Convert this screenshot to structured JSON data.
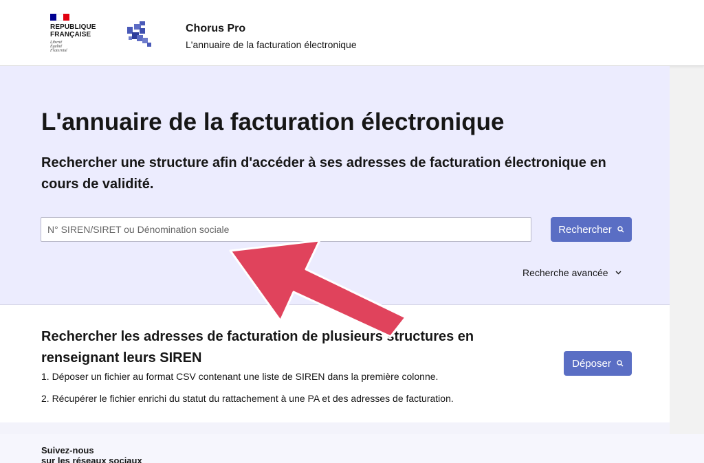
{
  "header": {
    "republic_name": "REPUBLIQUE\nFRANÇAISE",
    "republic_motto": "Liberté\nÉgalité\nFraternité",
    "flag_colors": [
      "#000091",
      "#ffffff",
      "#e1000f"
    ],
    "site_title": "Chorus Pro",
    "site_tagline": "L'annuaire de la facturation électronique",
    "logo_color": "#4a5ab8"
  },
  "hero": {
    "title": "L'annuaire de la facturation électronique",
    "subtitle": "Rechercher une structure afin d'accéder à ses adresses de facturation électronique en cours de validité.",
    "search": {
      "placeholder": "N° SIREN/SIRET ou Dénomination sociale",
      "value": "",
      "button_label": "Rechercher",
      "button_icon": "search-icon"
    },
    "advanced_search_label": "Recherche avancée",
    "advanced_search_icon": "chevron-down-icon"
  },
  "multi_search": {
    "title": "Rechercher les adresses de facturation de plusieurs structures en renseignant leurs SIREN",
    "steps": [
      "1. Déposer un fichier au format CSV contenant une liste de SIREN dans la première colonne.",
      "2. Récupérer le fichier enrichi du statut du rattachement à une PA et des adresses de facturation."
    ],
    "button_label": "Déposer",
    "button_icon": "search-icon"
  },
  "footer": {
    "follow_label": "Suivez-nous\nsur les réseaux sociaux"
  },
  "annotation": {
    "arrow_color": "#e0435c",
    "arrow_icon": "pointer-arrow-icon"
  },
  "colors": {
    "accent": "#5a6ec4",
    "hero_background": "#ececfe"
  }
}
